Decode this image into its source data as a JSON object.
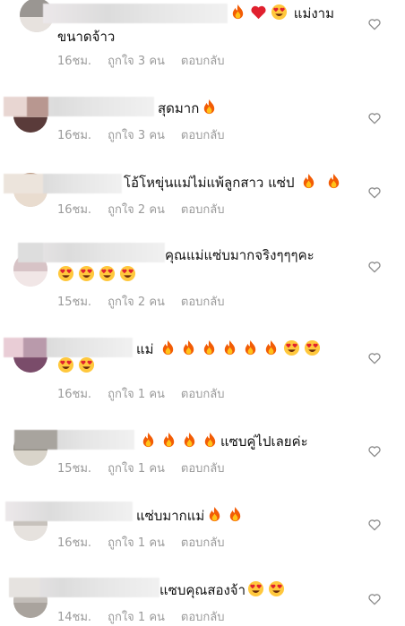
{
  "comments": [
    {
      "text": "แม่งาม",
      "text_line2": "ขนาดจ้าว",
      "emojis_line1": [
        "fire-emoji",
        "red-heart-emoji",
        "heart-eyes-emoji"
      ],
      "time": "16ชม.",
      "likes": "ถูกใจ 3 คน",
      "reply": "ตอบกลับ"
    },
    {
      "text": "สุดมาก",
      "emojis_after": [
        "fire-emoji"
      ],
      "time": "16ชม.",
      "likes": "ถูกใจ 3 คน",
      "reply": "ตอบกลับ"
    },
    {
      "text": "โอ้โหขุ่นแม่ไม่แพ้ลูกสาว แซ่ป",
      "emojis_after": [
        "fire-emoji",
        "fire-emoji"
      ],
      "time": "16ชม.",
      "likes": "ถูกใจ 2 คน",
      "reply": "ตอบกลับ"
    },
    {
      "text": "คุณแม่แซ่บมากจริงๆๆๆคะ",
      "emojis_line2": [
        "heart-eyes-emoji",
        "heart-eyes-emoji",
        "heart-eyes-emoji",
        "heart-eyes-emoji"
      ],
      "time": "15ชม.",
      "likes": "ถูกใจ 2 คน",
      "reply": "ตอบกลับ"
    },
    {
      "text": "แม่",
      "emojis_after": [
        "fire-emoji",
        "fire-emoji",
        "fire-emoji",
        "fire-emoji",
        "fire-emoji",
        "fire-emoji",
        "heart-eyes-emoji",
        "heart-eyes-emoji"
      ],
      "emojis_line2": [
        "heart-eyes-emoji",
        "heart-eyes-emoji"
      ],
      "time": "16ชม.",
      "likes": "ถูกใจ 1 คน",
      "reply": "ตอบกลับ"
    },
    {
      "text": "แซบคู่ไปเลยค่ะ",
      "emojis_before": [
        "fire-emoji",
        "fire-emoji",
        "fire-emoji",
        "fire-emoji"
      ],
      "time": "15ชม.",
      "likes": "ถูกใจ 1 คน",
      "reply": "ตอบกลับ"
    },
    {
      "text": "แซ่บมากแม่",
      "emojis_after": [
        "fire-emoji",
        "fire-emoji"
      ],
      "time": "16ชม.",
      "likes": "ถูกใจ 1 คน",
      "reply": "ตอบกลับ"
    },
    {
      "text": "แซบคุณสองจ้า",
      "emojis_after": [
        "heart-eyes-emoji",
        "heart-eyes-emoji"
      ],
      "time": "14ชม.",
      "likes": "ถูกใจ 1 คน",
      "reply": "ตอบกลับ"
    }
  ],
  "icons": {
    "like": "heart-outline-icon"
  },
  "colors": {
    "text": "#111111",
    "meta": "#9a9a9a",
    "heart_stroke": "#8e8e8e"
  }
}
